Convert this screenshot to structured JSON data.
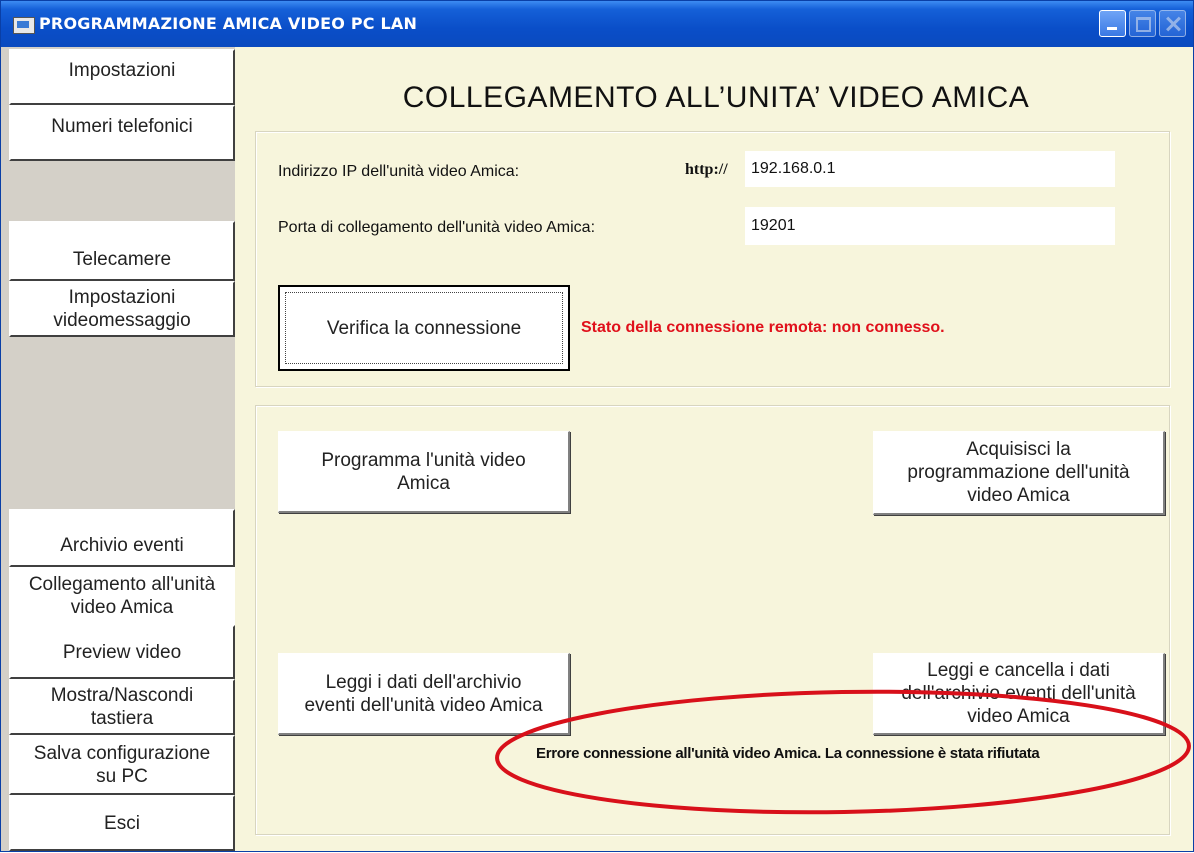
{
  "window": {
    "title": "PROGRAMMAZIONE AMICA VIDEO PC LAN"
  },
  "sidebar": {
    "items": [
      {
        "label": "Impostazioni"
      },
      {
        "label": "Numeri telefonici"
      },
      {
        "label": "Telecamere"
      },
      {
        "label": "Impostazioni\nvideomessaggio"
      },
      {
        "label": "Archivio eventi"
      },
      {
        "label": "Collegamento all'unità\nvideo Amica"
      },
      {
        "label": "Preview video"
      },
      {
        "label": "Mostra/Nascondi\ntastiera"
      },
      {
        "label": "Salva configurazione\nsu PC"
      },
      {
        "label": "Esci"
      }
    ],
    "active_index": 5
  },
  "main": {
    "heading": "COLLEGAMENTO ALL’UNITA’ VIDEO AMICA",
    "ip": {
      "label": "Indirizzo IP dell'unità video Amica:",
      "prefix": "http://",
      "value": "192.168.0.1"
    },
    "port": {
      "label": "Porta di collegamento dell'unità video Amica:",
      "value": "19201"
    },
    "verify_button": "Verifica la connessione",
    "connection_status": "Stato della connessione remota: non connesso.",
    "actions": {
      "program": "Programma l'unità video\nAmica",
      "acquire": "Acquisisci la\nprogrammazione dell'unità\nvideo Amica",
      "read_archive": "Leggi i dati dell'archivio\neventi dell'unità video Amica",
      "read_delete_archive": "Leggi e cancella i dati\ndell'archivio eventi dell'unità\nvideo Amica"
    },
    "error_message": "Errore connessione all'unità video Amica. La connessione è stata rifiutata",
    "annotation_color": "#d8101a"
  }
}
